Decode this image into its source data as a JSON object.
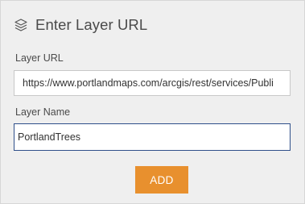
{
  "header": {
    "icon": "layers-icon",
    "title": "Enter Layer URL"
  },
  "form": {
    "url_label": "Layer URL",
    "url_value": "https://www.portlandmaps.com/arcgis/rest/services/Publi",
    "name_label": "Layer Name",
    "name_value": "PortlandTrees"
  },
  "actions": {
    "add_label": "ADD"
  },
  "colors": {
    "panel_background": "#efefef",
    "add_button": "#e8902e",
    "focused_border": "#2f4f8a"
  }
}
